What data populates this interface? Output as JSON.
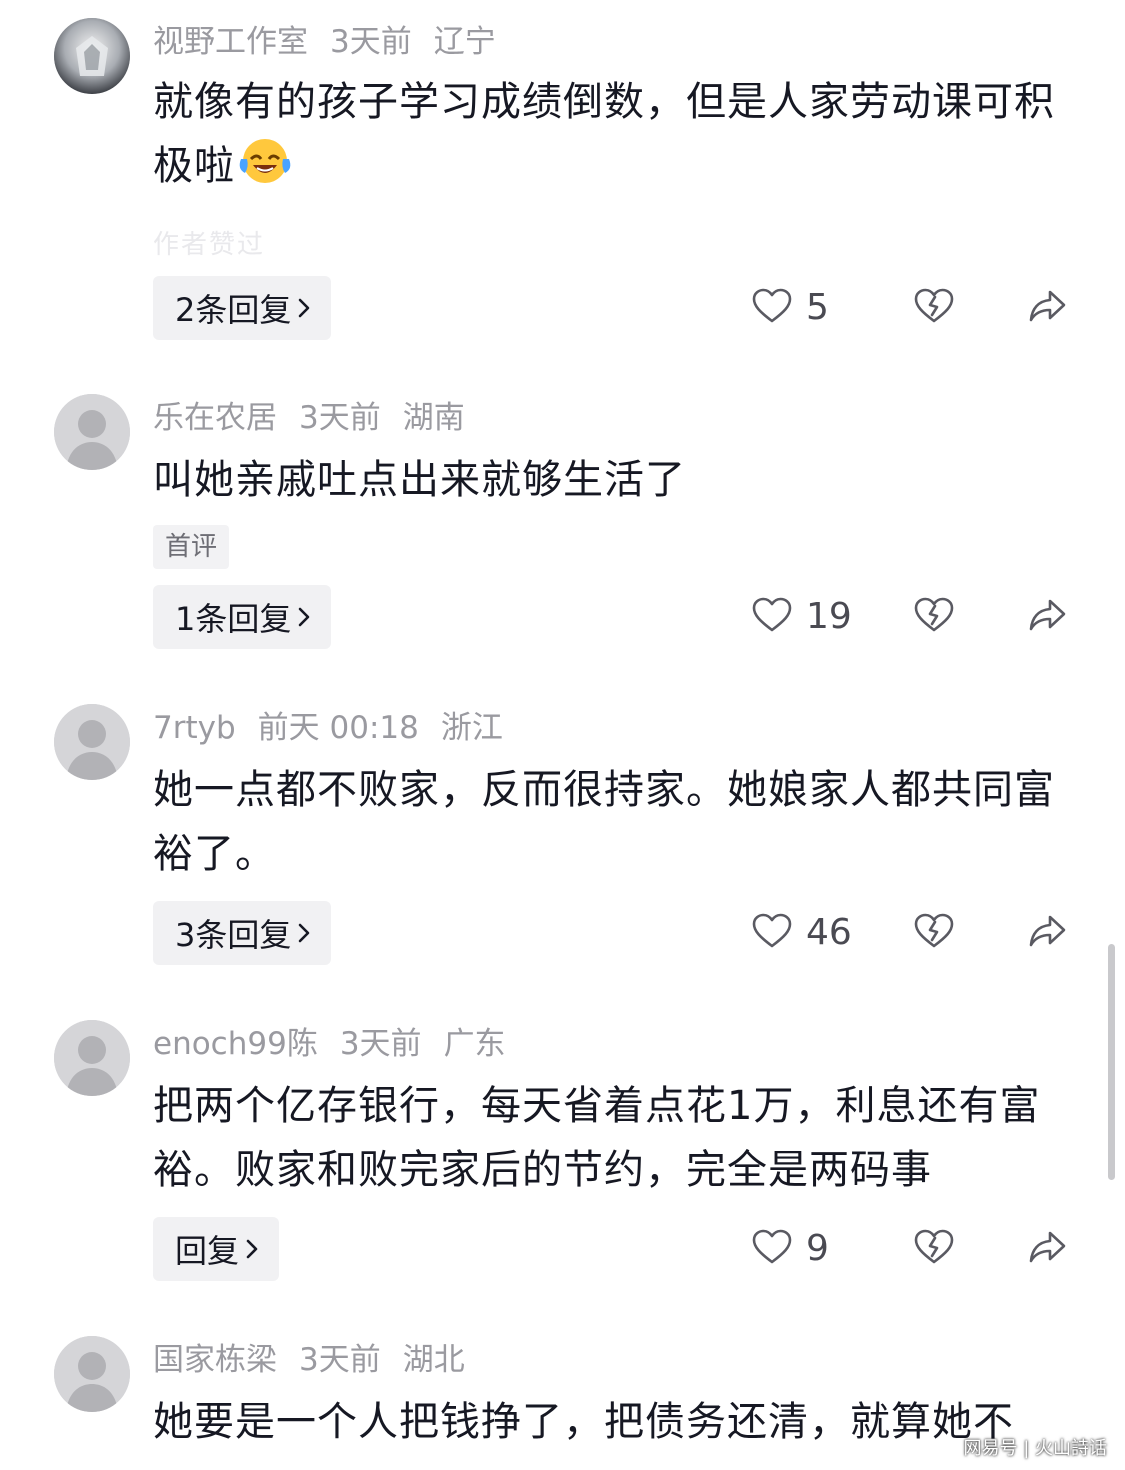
{
  "comments": [
    {
      "username": "视野工作室",
      "time": "3天前",
      "location": "辽宁",
      "text": "就像有的孩子学习成绩倒数，但是人家劳动课可积极啦",
      "emoji": "laughing-crying-emoji",
      "faded_tag": "作者赞过",
      "reply_label": "2条回复",
      "likes": "5"
    },
    {
      "username": "乐在农居",
      "time": "3天前",
      "location": "湖南",
      "text": "叫她亲戚吐点出来就够生活了",
      "tag": "首评",
      "reply_label": "1条回复",
      "likes": "19"
    },
    {
      "username": "7rtyb",
      "time": "前天 00:18",
      "location": "浙江",
      "text": "她一点都不败家，反而很持家。她娘家人都共同富裕了。",
      "reply_label": "3条回复",
      "likes": "46"
    },
    {
      "username": "enoch99陈",
      "time": "3天前",
      "location": "广东",
      "text": "把两个亿存银行，每天省着点花1万，利息还有富裕。败家和败完家后的节约，完全是两码事",
      "reply_label": "回复",
      "likes": "9"
    },
    {
      "username": "国家栋梁",
      "time": "3天前",
      "location": "湖北",
      "text": "她要是一个人把钱挣了，把债务还清，就算她不"
    }
  ],
  "watermark": "网易号 | 火山詩话",
  "icons": {
    "like": "heart-outline-icon",
    "dislike": "broken-heart-icon",
    "share": "share-arrow-icon",
    "reply_chevron": "chevron-right-icon"
  },
  "colors": {
    "meta_text": "#9a9aa0",
    "body_text": "#161823",
    "button_bg": "#f1f1f3",
    "icon_stroke": "#5a5a62"
  }
}
